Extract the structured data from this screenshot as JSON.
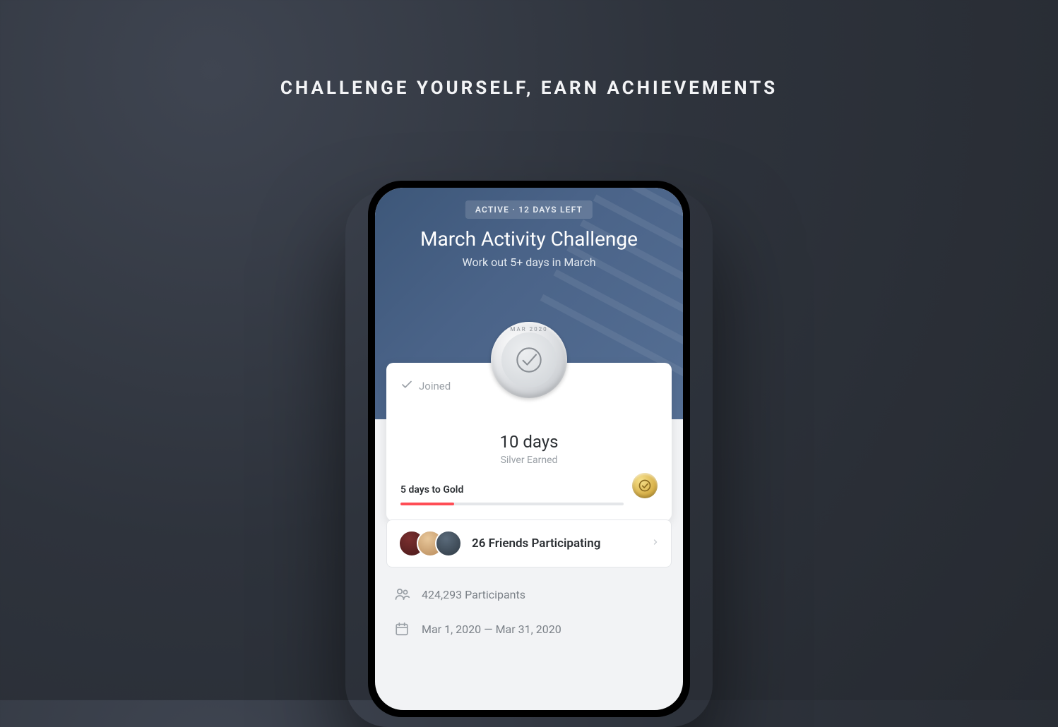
{
  "headline": "CHALLENGE YOURSELF, EARN ACHIEVEMENTS",
  "hero": {
    "status_pill": "ACTIVE · 12 DAYS LEFT",
    "title": "March Activity Challenge",
    "subtitle": "Work out 5+ days in March"
  },
  "medal": {
    "arc_text": "MAR 2020",
    "days_value": "10 days",
    "earned_label": "Silver Earned"
  },
  "progress": {
    "label": "5 days to Gold",
    "percent": 24
  },
  "joined_label": "Joined",
  "friends": {
    "text": "26 Friends Participating"
  },
  "participants_text": "424,293 Participants",
  "date_range_text": "Mar 1, 2020 — Mar 31, 2020"
}
